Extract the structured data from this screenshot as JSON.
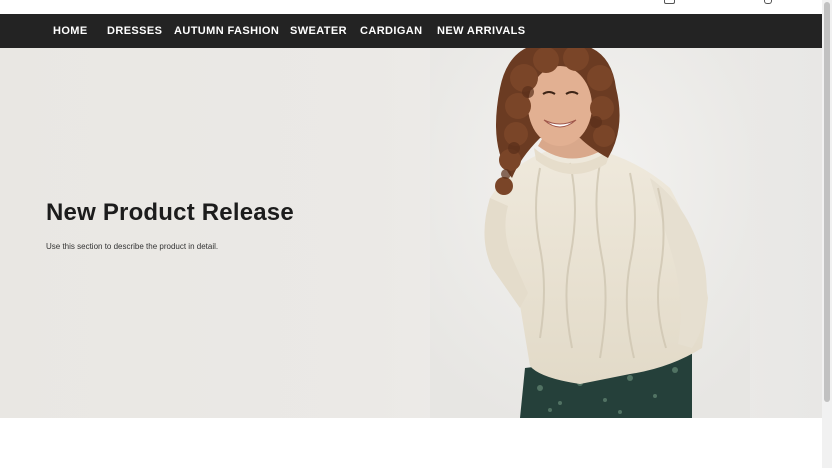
{
  "nav": {
    "items": [
      {
        "label": "HOME"
      },
      {
        "label": "DRESSES"
      },
      {
        "label": "AUTUMN FASHION"
      },
      {
        "label": "SWEATER"
      },
      {
        "label": "CARDIGAN"
      },
      {
        "label": "NEW ARRIVALS"
      }
    ]
  },
  "hero": {
    "title": "New Product Release",
    "description": "Use this section to describe the product in detail."
  },
  "colors": {
    "nav_background": "#232323",
    "nav_text": "#ffffff",
    "hero_background": "#ebe9e6",
    "title_text": "#1c1c1c"
  },
  "icons": [
    "bag-icon",
    "account-icon"
  ]
}
